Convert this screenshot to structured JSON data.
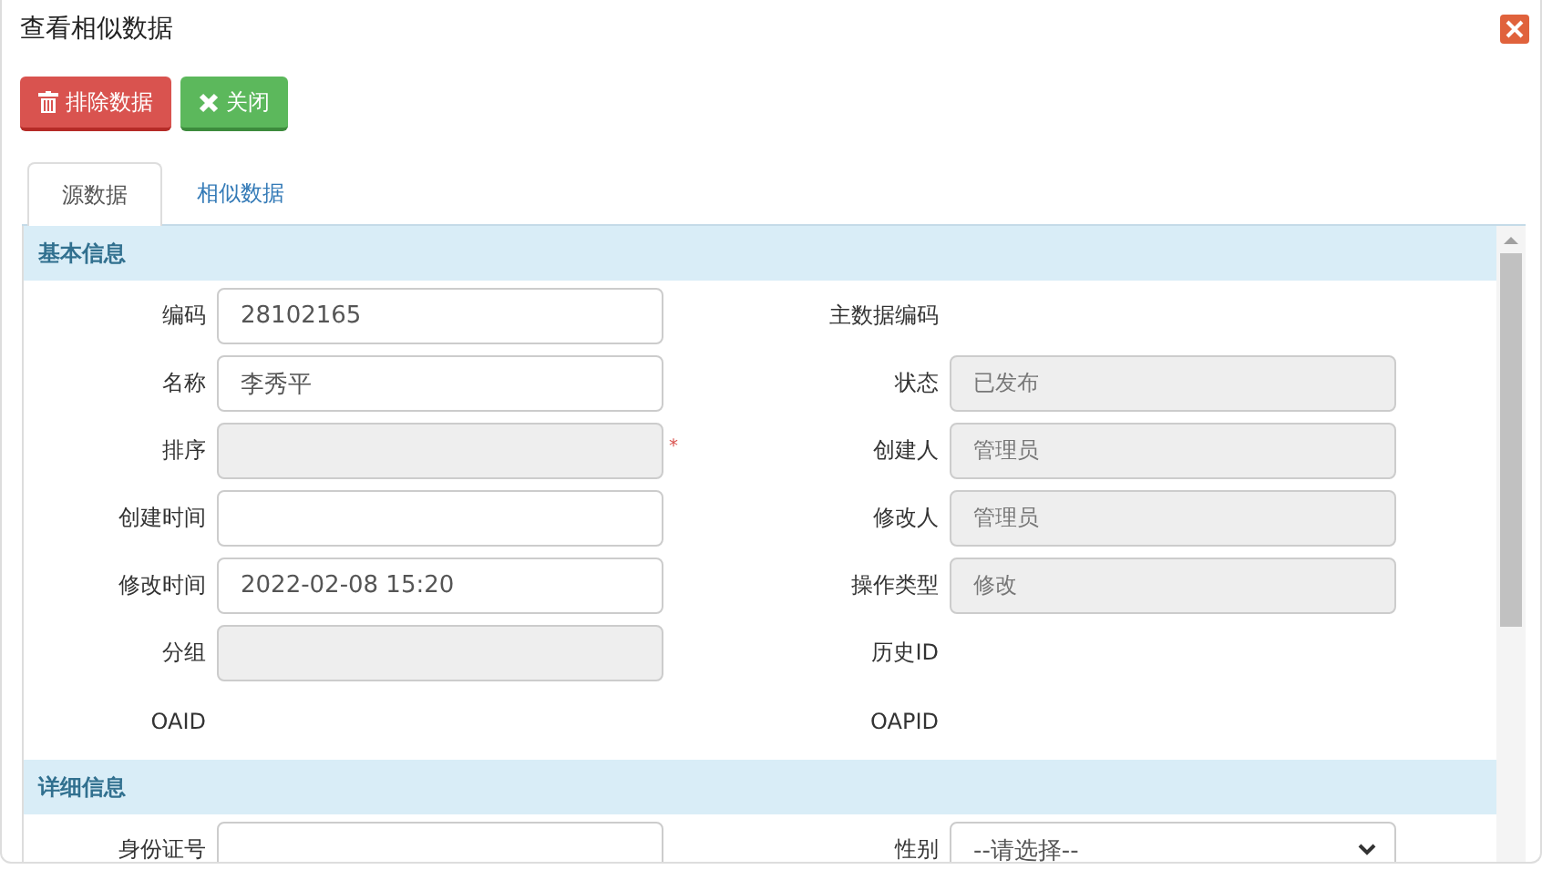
{
  "window": {
    "title": "查看相似数据"
  },
  "buttons": [
    {
      "kind": "danger",
      "label": "排除数据"
    },
    {
      "kind": "success",
      "label": "关闭"
    }
  ],
  "tabs": [
    {
      "label": "源数据",
      "selected": true
    },
    {
      "label": "相似数据",
      "selected": false
    }
  ],
  "sections": [
    {
      "title": "基本信息",
      "fields": [
        {
          "label": "编码",
          "kind": "input",
          "value": "28102165"
        },
        {
          "label": "主数据编码",
          "kind": "none"
        },
        {
          "label": "名称",
          "kind": "input",
          "value": "李秀平"
        },
        {
          "label": "状态",
          "kind": "readonly",
          "value": "已发布"
        },
        {
          "label": "排序",
          "kind": "readonly",
          "required_mark": "*"
        },
        {
          "label": "创建人",
          "kind": "readonly",
          "value": "管理员"
        },
        {
          "label": "创建时间",
          "kind": "input"
        },
        {
          "label": "修改人",
          "kind": "readonly",
          "value": "管理员"
        },
        {
          "label": "修改时间",
          "kind": "input",
          "value": "2022-02-08 15:20"
        },
        {
          "label": "操作类型",
          "kind": "readonly",
          "value": "修改"
        },
        {
          "label": "分组",
          "kind": "readonly"
        },
        {
          "label": "历史ID",
          "kind": "none"
        },
        {
          "label": "OAID",
          "kind": "none"
        },
        {
          "label": "OAPID",
          "kind": "none"
        }
      ]
    },
    {
      "title": "详细信息",
      "fields": [
        {
          "label": "身份证号",
          "kind": "input"
        },
        {
          "label": "性别",
          "kind": "select",
          "value": "--请选择--"
        }
      ]
    }
  ]
}
